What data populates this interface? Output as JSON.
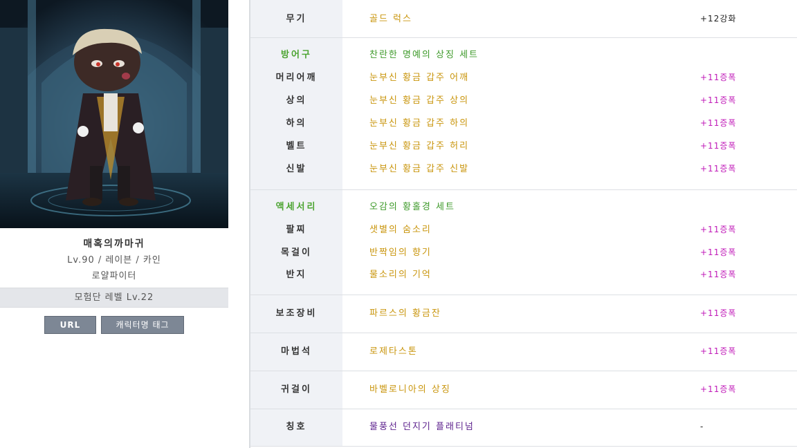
{
  "character": {
    "name": "매혹의까마귀",
    "info": "Lv.90 / 레이븐 / 카인",
    "job": "로얄파이터",
    "guild_level": "모험단 레벨 Lv.22"
  },
  "buttons": {
    "url": "URL",
    "tag": "캐릭터명 태그"
  },
  "equipment": {
    "weapon": {
      "category": "무기",
      "item": "골드 럭스",
      "upgrade": "+12강화"
    },
    "armor": {
      "category": "방어구",
      "set_name": "찬란한 명예의 상징 세트",
      "rows": [
        {
          "category": "머리어깨",
          "item": "눈부신 황금 갑주 어깨",
          "upgrade": "+11증폭"
        },
        {
          "category": "상의",
          "item": "눈부신 황금 갑주 상의",
          "upgrade": "+11증폭"
        },
        {
          "category": "하의",
          "item": "눈부신 황금 갑주 하의",
          "upgrade": "+11증폭"
        },
        {
          "category": "벨트",
          "item": "눈부신 황금 갑주 허리",
          "upgrade": "+11증폭"
        },
        {
          "category": "신발",
          "item": "눈부신 황금 갑주 신발",
          "upgrade": "+11증폭"
        }
      ]
    },
    "accessory": {
      "category": "액세서리",
      "set_name": "오감의 황홀경 세트",
      "rows": [
        {
          "category": "팔찌",
          "item": "샛별의 숨소리",
          "upgrade": "+11증폭"
        },
        {
          "category": "목걸이",
          "item": "반짝임의 향기",
          "upgrade": "+11증폭"
        },
        {
          "category": "반지",
          "item": "물소리의 기억",
          "upgrade": "+11증폭"
        }
      ]
    },
    "sub_weapon": {
      "category": "보조장비",
      "item": "파르스의 황금잔",
      "upgrade": "+11증폭"
    },
    "magic_stone": {
      "category": "마법석",
      "item": "로제타스톤",
      "upgrade": "+11증폭"
    },
    "earring": {
      "category": "귀걸이",
      "item": "바벨로니아의 상징",
      "upgrade": "+11증폭"
    },
    "title": {
      "category": "칭호",
      "item": "물풍선 던지기 플래티넘",
      "upgrade": "-"
    }
  },
  "colors": {
    "item_gold": "#c9950c",
    "set_green": "#3e9a2a",
    "upgrade_magenta": "#c01ab8",
    "title_purple": "#5b1f8c",
    "label_bg": "#f0f2f6"
  }
}
